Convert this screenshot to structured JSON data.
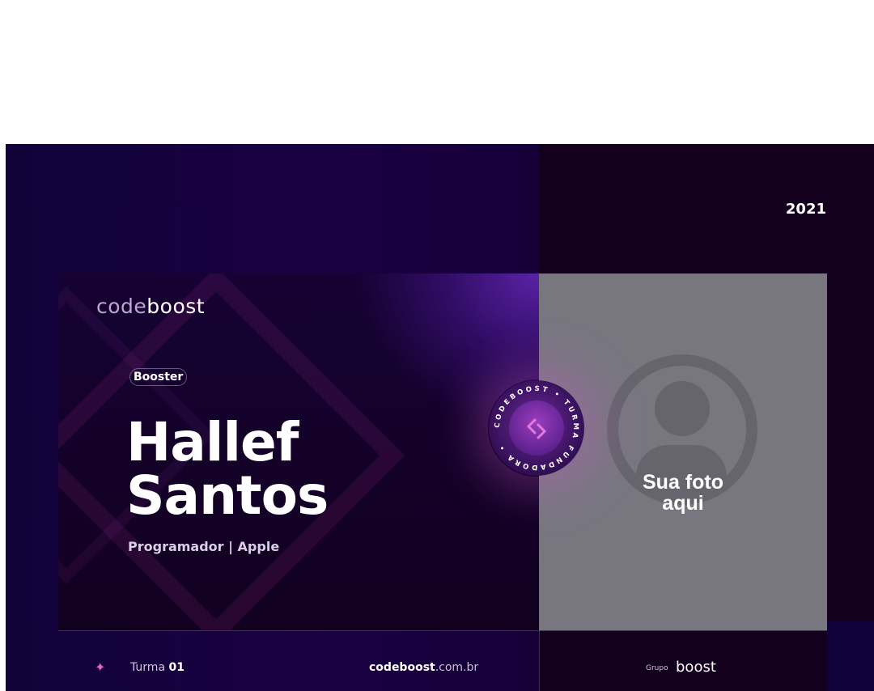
{
  "card": {
    "year": "2021",
    "logo_light": "code",
    "logo_bold": "boost",
    "badge": "Booster",
    "name_line1": "Hallef",
    "name_line2": "Santos",
    "role": "Programador | Apple",
    "photo_placeholder": "Sua foto\naqui",
    "seal_text": "CODEBOOST • TURMA FUNDADORA •",
    "seal_icon": "code-brackets-icon"
  },
  "footer": {
    "star_icon": "sparkle-icon",
    "turma_label": "Turma",
    "turma_number": "01",
    "site_bold": "codeboost",
    "site_light": ".com.br",
    "grupo_label": "Grupo",
    "grupo_brand": "boost"
  },
  "colors": {
    "background": "#13002a",
    "accent_purple": "#5a22a6",
    "accent_pink": "#e062c8",
    "photo_bg": "#787780"
  }
}
